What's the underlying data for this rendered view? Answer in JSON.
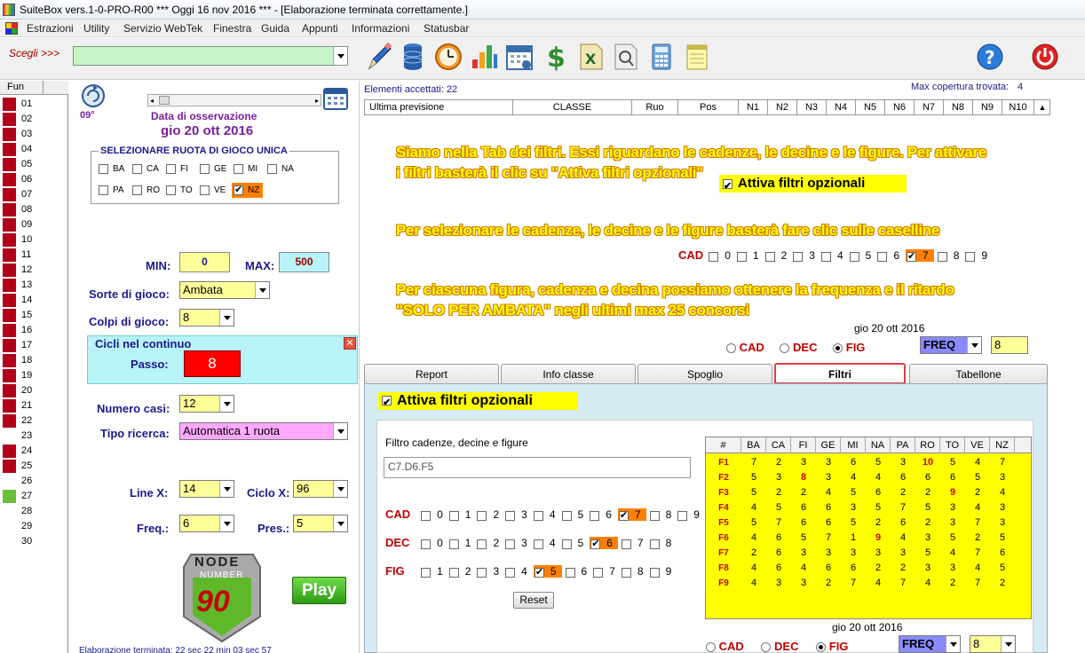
{
  "window": {
    "title": "SuiteBox vers.1-0-PRO-R00  ***  Oggi 16 nov 2016  ***   - [Elaborazione terminata correttamente.]"
  },
  "menu": [
    "Estrazioni",
    "Utility",
    "Servizio WebTek",
    "Finestra",
    "Guida",
    "Appunti",
    "Informazioni",
    "Statusbar"
  ],
  "toolbar": {
    "scegli_label": "Scegli >>>",
    "scegli_value": ""
  },
  "fun": {
    "header": "Fun",
    "rows": [
      {
        "n": "01",
        "c": "red"
      },
      {
        "n": "02",
        "c": "red"
      },
      {
        "n": "03",
        "c": "red"
      },
      {
        "n": "04",
        "c": "red"
      },
      {
        "n": "05",
        "c": "red"
      },
      {
        "n": "06",
        "c": "red"
      },
      {
        "n": "07",
        "c": "red"
      },
      {
        "n": "08",
        "c": "red"
      },
      {
        "n": "09",
        "c": "red"
      },
      {
        "n": "10",
        "c": "red"
      },
      {
        "n": "11",
        "c": "red"
      },
      {
        "n": "12",
        "c": "red"
      },
      {
        "n": "13",
        "c": "red"
      },
      {
        "n": "14",
        "c": "red"
      },
      {
        "n": "15",
        "c": "red"
      },
      {
        "n": "16",
        "c": "red"
      },
      {
        "n": "17",
        "c": "red"
      },
      {
        "n": "18",
        "c": "red"
      },
      {
        "n": "19",
        "c": "red"
      },
      {
        "n": "20",
        "c": "red"
      },
      {
        "n": "21",
        "c": "red"
      },
      {
        "n": "22",
        "c": "red"
      },
      {
        "n": "23",
        "c": "white"
      },
      {
        "n": "24",
        "c": "red"
      },
      {
        "n": "25",
        "c": "red"
      },
      {
        "n": "26",
        "c": "white"
      },
      {
        "n": "27",
        "c": "green"
      },
      {
        "n": "28",
        "c": "white"
      },
      {
        "n": "29",
        "c": "white"
      },
      {
        "n": "30",
        "c": "white"
      }
    ]
  },
  "obs": {
    "deg": "09°",
    "label": "Data di osservazione",
    "date": "gio 20 ott 2016",
    "ruota_title": "SELEZIONARE RUOTA DI GIOCO UNICA",
    "ruote_row1": [
      "BA",
      "CA",
      "FI",
      "GE",
      "MI",
      "NA"
    ],
    "ruote_row2": [
      "PA",
      "RO",
      "TO",
      "VE",
      "NZ"
    ],
    "ruota_selected": "NZ",
    "min_label": "MIN:",
    "min_value": "0",
    "max_label": "MAX:",
    "max_value": "500",
    "sorte_label": "Sorte di gioco:",
    "sorte_value": "Ambata",
    "colpi_label": "Colpi di gioco:",
    "colpi_value": "8",
    "cicli_title": "Cicli nel continuo",
    "passo_label": "Passo:",
    "passo_value": "8",
    "casi_label": "Numero casi:",
    "casi_value": "12",
    "tipo_label": "Tipo ricerca:",
    "tipo_value": "Automatica 1 ruota",
    "linex_label": "Line X:",
    "linex_value": "14",
    "ciclox_label": "Ciclo X:",
    "ciclox_value": "96",
    "freq_label": "Freq.:",
    "freq_value": "6",
    "pres_label": "Pres.:",
    "pres_value": "5",
    "logo_line1": "NODE",
    "logo_line2": "NUMBER",
    "logo_num": "90",
    "play_label": "Play",
    "status_text": "Elaborazione terminata: 22 sec 22 min 03 sec  57"
  },
  "right": {
    "elementi": "Elementi accettati: 22",
    "maxcop": "Max copertura trovata:",
    "maxcop_value": "4",
    "table_headers": [
      "Ultima previsione",
      "CLASSE",
      "Ruo",
      "Pos",
      "N1",
      "N2",
      "N3",
      "N4",
      "N5",
      "N6",
      "N7",
      "N8",
      "N9",
      "N10"
    ],
    "ann1_line1": "Siamo nella Tab dei filtri. Essi riguardano le cadenze, le decine e le figure. Per attivare",
    "ann1_line2": "i filtri basterà il clic su \"Attiva filtri opzionali\"",
    "attiva_label": "Attiva filtri opzionali",
    "ann2": "Per selezionare le cadenze, le decine e le figure basterà fare clic sulle caselline",
    "cad_label": "CAD",
    "cad_digits": [
      "0",
      "1",
      "2",
      "3",
      "4",
      "5",
      "6",
      "7",
      "8",
      "9"
    ],
    "cad_selected": "7",
    "ann3_line1": "Per ciascuna figura, cadenza e decina possiamo ottenere la frequenza e il ritardo",
    "ann3_line2": "\"SOLO PER AMBATA\" negli ultimi max 25 concorsi",
    "date_small": "gio 20 ott 2016",
    "radio_cad": "CAD",
    "radio_dec": "DEC",
    "radio_fig": "FIG",
    "freq_value": "FREQ",
    "eight_value": "8"
  },
  "tabs": [
    "Report",
    "Info classe",
    "Spoglio",
    "Filtri",
    "Tabellone"
  ],
  "tab_active": "Filtri",
  "filtri": {
    "attiva_label": "Attiva filtri opzionali",
    "filter_title": "Filtro cadenze, decine e figure",
    "filter_value": "C7.D6.F5",
    "cad_label": "CAD",
    "cad_digits": [
      "0",
      "1",
      "2",
      "3",
      "4",
      "5",
      "6",
      "7",
      "8",
      "9"
    ],
    "cad_selected": "7",
    "dec_label": "DEC",
    "dec_digits": [
      "0",
      "1",
      "2",
      "3",
      "4",
      "5",
      "6",
      "7",
      "8"
    ],
    "dec_selected": "6",
    "fig_label": "FIG",
    "fig_digits": [
      "1",
      "2",
      "3",
      "4",
      "5",
      "6",
      "7",
      "8",
      "9"
    ],
    "fig_selected": "5",
    "reset_label": "Reset",
    "bottom_date": "gio 20 ott 2016",
    "radio_cad": "CAD",
    "radio_dec": "DEC",
    "radio_fig": "FIG",
    "freq_value": "FREQ",
    "eight_value": "8",
    "grid_headers": [
      "#",
      "BA",
      "CA",
      "FI",
      "GE",
      "MI",
      "NA",
      "PA",
      "RO",
      "TO",
      "VE",
      "NZ"
    ],
    "grid_rows": [
      {
        "label": "F1",
        "vals": [
          "7",
          "2",
          "3",
          "3",
          "6",
          "5",
          "3",
          "10",
          "5",
          "4",
          "7"
        ],
        "red": [
          7
        ]
      },
      {
        "label": "F2",
        "vals": [
          "5",
          "3",
          "8",
          "3",
          "4",
          "4",
          "6",
          "6",
          "6",
          "5",
          "3"
        ],
        "red": [
          2
        ]
      },
      {
        "label": "F3",
        "vals": [
          "5",
          "2",
          "2",
          "4",
          "5",
          "6",
          "2",
          "2",
          "9",
          "2",
          "4"
        ],
        "red": [
          8
        ]
      },
      {
        "label": "F4",
        "vals": [
          "4",
          "5",
          "6",
          "6",
          "3",
          "5",
          "7",
          "5",
          "3",
          "4",
          "3"
        ],
        "red": []
      },
      {
        "label": "F5",
        "vals": [
          "5",
          "7",
          "6",
          "6",
          "5",
          "2",
          "6",
          "2",
          "3",
          "7",
          "3"
        ],
        "red": []
      },
      {
        "label": "F6",
        "vals": [
          "4",
          "6",
          "5",
          "7",
          "1",
          "9",
          "4",
          "3",
          "5",
          "2",
          "5"
        ],
        "red": [
          5
        ]
      },
      {
        "label": "F7",
        "vals": [
          "2",
          "6",
          "3",
          "3",
          "3",
          "3",
          "3",
          "5",
          "4",
          "7",
          "6"
        ],
        "red": []
      },
      {
        "label": "F8",
        "vals": [
          "4",
          "6",
          "4",
          "6",
          "6",
          "2",
          "2",
          "3",
          "3",
          "4",
          "5"
        ],
        "red": []
      },
      {
        "label": "F9",
        "vals": [
          "4",
          "3",
          "3",
          "2",
          "7",
          "4",
          "7",
          "4",
          "2",
          "7",
          "2"
        ],
        "red": []
      }
    ]
  }
}
